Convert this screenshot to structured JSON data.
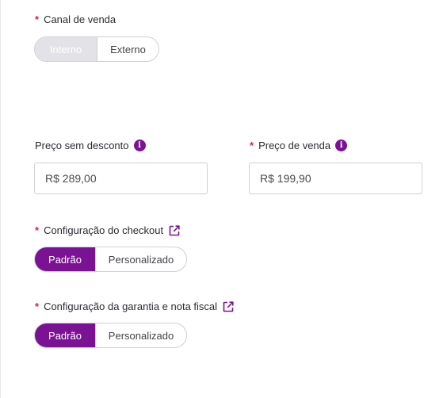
{
  "sales_channel": {
    "label": "Canal de venda",
    "options": [
      "Interno",
      "Externo"
    ],
    "selected": "Interno"
  },
  "price_no_discount": {
    "label": "Preço sem desconto",
    "value": "R$ 289,00"
  },
  "sale_price": {
    "label": "Preço de venda",
    "value": "R$ 199,90"
  },
  "checkout_config": {
    "label": "Configuração do checkout",
    "options": [
      "Padrão",
      "Personalizado"
    ],
    "selected": "Padrão"
  },
  "warranty_config": {
    "label": "Configuração da garantia e nota fiscal",
    "options": [
      "Padrão",
      "Personalizado"
    ],
    "selected": "Padrão"
  },
  "required_mark": "*",
  "colors": {
    "accent": "#7b1294",
    "required": "#d6214a",
    "disabled_fill": "#e3e3e7",
    "border": "#cfd0d6"
  },
  "icons": [
    "info-icon",
    "external-link-icon"
  ]
}
